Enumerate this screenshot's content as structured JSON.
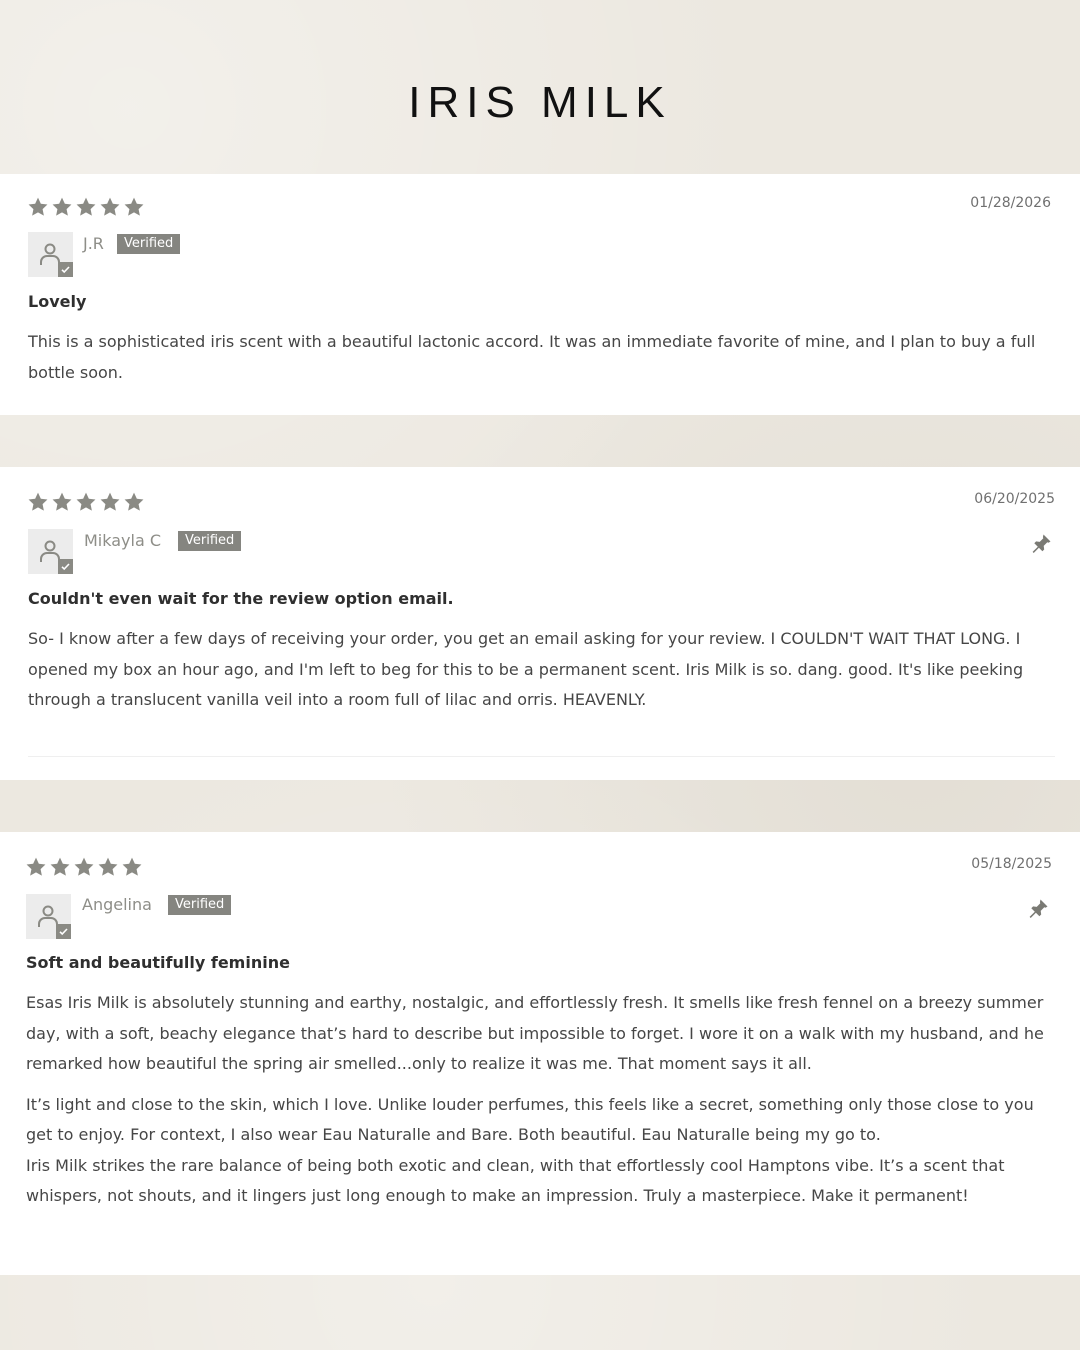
{
  "page": {
    "title": "IRIS MILK"
  },
  "colors": {
    "star": "#8a8a84",
    "badge": "#858580",
    "pin": "#7a7a74"
  },
  "icons": {
    "star": "star-icon",
    "avatar": "user-avatar-icon",
    "pin": "pin-icon",
    "verified": "check-icon"
  },
  "reviews": [
    {
      "rating": 5,
      "date": "01/28/2026",
      "author": "J.R",
      "badge": "Verified",
      "pinned": false,
      "title": "Lovely",
      "paragraphs": [
        "This is a sophisticated iris scent with a beautiful lactonic accord. It was an immediate favorite of mine, and I plan to buy a full bottle soon."
      ]
    },
    {
      "rating": 5,
      "date": "06/20/2025",
      "author": "Mikayla C",
      "badge": "Verified",
      "pinned": true,
      "title": "Couldn't even wait for the review option email.",
      "paragraphs": [
        "So- I know after a few days of receiving your order, you get an email asking for your review. I COULDN'T WAIT THAT LONG. I opened my box an hour ago, and I'm left to beg for this to be a permanent scent. Iris Milk is so. dang. good. It's like peeking through a translucent vanilla veil into a room full of lilac and orris. HEAVENLY."
      ]
    },
    {
      "rating": 5,
      "date": "05/18/2025",
      "author": "Angelina",
      "badge": "Verified",
      "pinned": true,
      "title": "Soft and beautifully feminine",
      "paragraphs": [
        "Esas Iris Milk is absolutely stunning and earthy, nostalgic, and effortlessly fresh. It smells like fresh fennel on a breezy summer day, with a soft, beachy elegance that’s hard to describe but impossible to forget. I wore it on a walk with my husband, and he remarked how beautiful the spring air smelled...only to realize it was me. That moment says it all.",
        "It’s light and close to the skin, which I love. Unlike louder perfumes, this feels like a secret, something only those close to you get to enjoy. For context, I also wear Eau Naturalle and Bare. Both beautiful. Eau Naturalle being my go to.",
        "Iris Milk strikes the rare balance of being both exotic and clean, with that effortlessly cool Hamptons vibe. It’s a scent that whispers, not shouts, and it lingers just long enough to make an impression. Truly a masterpiece. Make it permanent!"
      ]
    }
  ]
}
